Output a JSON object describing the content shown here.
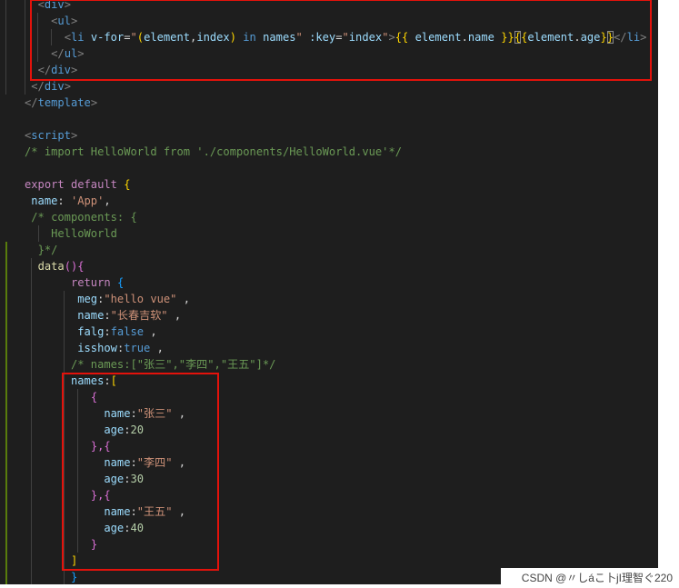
{
  "theme": {
    "editor_background": "#1e1e1e",
    "annotation_color": "#e3120b",
    "git_added_color": "#587c0c",
    "bracket_match_border": "#8b8b8b"
  },
  "editor": {
    "lines": [
      [
        [
          "  "
        ],
        [
          "<",
          "#808080"
        ],
        [
          "div",
          "#569cd6"
        ],
        [
          ">",
          "#808080"
        ]
      ],
      [
        [
          "    "
        ],
        [
          "<",
          "#808080"
        ],
        [
          "ul",
          "#569cd6"
        ],
        [
          ">",
          "#808080"
        ]
      ],
      [
        [
          "      "
        ],
        [
          "<",
          "#808080"
        ],
        [
          "li",
          "#569cd6"
        ],
        [
          " "
        ],
        [
          "v-for",
          "#9cdcfe"
        ],
        [
          "=",
          "#d4d4d4"
        ],
        [
          "\"",
          "#ce9178"
        ],
        [
          "(",
          "#ffd700"
        ],
        [
          "element",
          "#9cdcfe"
        ],
        [
          ",",
          "#d4d4d4"
        ],
        [
          "index",
          "#9cdcfe"
        ],
        [
          ")",
          "#ffd700"
        ],
        [
          " "
        ],
        [
          "in",
          "#569cd6"
        ],
        [
          " "
        ],
        [
          "names",
          "#9cdcfe"
        ],
        [
          "\"",
          "#ce9178"
        ],
        [
          " "
        ],
        [
          ":key",
          "#9cdcfe"
        ],
        [
          "=",
          "#d4d4d4"
        ],
        [
          "\"",
          "#ce9178"
        ],
        [
          "index",
          "#9cdcfe"
        ],
        [
          "\"",
          "#ce9178"
        ],
        [
          ">",
          "#808080"
        ],
        [
          "{{",
          "#ffd700"
        ],
        [
          " "
        ],
        [
          "element",
          "#9cdcfe"
        ],
        [
          ".",
          "#d4d4d4"
        ],
        [
          "name",
          "#9cdcfe"
        ],
        [
          " "
        ],
        [
          "}}",
          "#ffd700"
        ],
        [
          "{",
          "#ffd700",
          true
        ],
        [
          "{",
          "#ffd700"
        ],
        [
          "element",
          "#9cdcfe"
        ],
        [
          ".",
          "#d4d4d4"
        ],
        [
          "age",
          "#9cdcfe"
        ],
        [
          "}",
          "#ffd700"
        ],
        [
          "}",
          "#ffd700",
          true
        ],
        [
          "</",
          "#808080"
        ],
        [
          "li",
          "#569cd6"
        ],
        [
          ">",
          "#808080"
        ]
      ],
      [
        [
          "    "
        ],
        [
          "</",
          "#808080"
        ],
        [
          "ul",
          "#569cd6"
        ],
        [
          ">",
          "#808080"
        ]
      ],
      [
        [
          "  "
        ],
        [
          "</",
          "#808080"
        ],
        [
          "div",
          "#569cd6"
        ],
        [
          ">",
          "#808080"
        ]
      ],
      [
        [
          " "
        ],
        [
          "</",
          "#808080"
        ],
        [
          "div",
          "#569cd6"
        ],
        [
          ">",
          "#808080"
        ]
      ],
      [
        [
          "</",
          "#808080"
        ],
        [
          "template",
          "#569cd6"
        ],
        [
          ">",
          "#808080"
        ]
      ],
      [],
      [
        [
          "<",
          "#808080"
        ],
        [
          "script",
          "#569cd6"
        ],
        [
          ">",
          "#808080"
        ]
      ],
      [
        [
          "/* import HelloWorld from './components/HelloWorld.vue'*/",
          "#6a9955"
        ]
      ],
      [],
      [
        [
          "export",
          "#c586c0"
        ],
        [
          " "
        ],
        [
          "default",
          "#c586c0"
        ],
        [
          " "
        ],
        [
          "{",
          "#ffd700"
        ]
      ],
      [
        [
          " "
        ],
        [
          "name",
          "#9cdcfe"
        ],
        [
          ":",
          "#d4d4d4"
        ],
        [
          " "
        ],
        [
          "'App'",
          "#ce9178"
        ],
        [
          ",",
          "#d4d4d4"
        ]
      ],
      [
        [
          " "
        ],
        [
          "/* components: {",
          "#6a9955"
        ]
      ],
      [
        [
          "    "
        ],
        [
          "HelloWorld",
          "#6a9955"
        ]
      ],
      [
        [
          "  "
        ],
        [
          "}*/",
          "#6a9955"
        ]
      ],
      [
        [
          "  "
        ],
        [
          "data",
          "#dcdcaa"
        ],
        [
          "()",
          "#da70d6"
        ],
        [
          "{",
          "#da70d6"
        ]
      ],
      [
        [
          "       "
        ],
        [
          "return",
          "#c586c0"
        ],
        [
          " "
        ],
        [
          "{",
          "#179fff"
        ]
      ],
      [
        [
          "        "
        ],
        [
          "meg",
          "#9cdcfe"
        ],
        [
          ":",
          "#d4d4d4"
        ],
        [
          "\"hello vue\"",
          "#ce9178"
        ],
        [
          " ,",
          "#d4d4d4"
        ]
      ],
      [
        [
          "        "
        ],
        [
          "name",
          "#9cdcfe"
        ],
        [
          ":",
          "#d4d4d4"
        ],
        [
          "\"长春吉软\"",
          "#ce9178"
        ],
        [
          " ,",
          "#d4d4d4"
        ]
      ],
      [
        [
          "        "
        ],
        [
          "falg",
          "#9cdcfe"
        ],
        [
          ":",
          "#d4d4d4"
        ],
        [
          "false",
          "#569cd6"
        ],
        [
          " ,",
          "#d4d4d4"
        ]
      ],
      [
        [
          "        "
        ],
        [
          "isshow",
          "#9cdcfe"
        ],
        [
          ":",
          "#d4d4d4"
        ],
        [
          "true",
          "#569cd6"
        ],
        [
          " ,",
          "#d4d4d4"
        ]
      ],
      [
        [
          "       "
        ],
        [
          "/* names:[\"张三\",\"李四\",\"王五\"]*/",
          "#6a9955"
        ]
      ],
      [
        [
          "       "
        ],
        [
          "names",
          "#9cdcfe"
        ],
        [
          ":",
          "#d4d4d4"
        ],
        [
          "[",
          "#ffd700"
        ]
      ],
      [
        [
          "          "
        ],
        [
          "{",
          "#da70d6"
        ]
      ],
      [
        [
          "            "
        ],
        [
          "name",
          "#9cdcfe"
        ],
        [
          ":",
          "#d4d4d4"
        ],
        [
          "\"张三\"",
          "#ce9178"
        ],
        [
          " ,",
          "#d4d4d4"
        ]
      ],
      [
        [
          "            "
        ],
        [
          "age",
          "#9cdcfe"
        ],
        [
          ":",
          "#d4d4d4"
        ],
        [
          "20",
          "#b5cea8"
        ]
      ],
      [
        [
          "          "
        ],
        [
          "},{",
          "#da70d6"
        ]
      ],
      [
        [
          "            "
        ],
        [
          "name",
          "#9cdcfe"
        ],
        [
          ":",
          "#d4d4d4"
        ],
        [
          "\"李四\"",
          "#ce9178"
        ],
        [
          " ,",
          "#d4d4d4"
        ]
      ],
      [
        [
          "            "
        ],
        [
          "age",
          "#9cdcfe"
        ],
        [
          ":",
          "#d4d4d4"
        ],
        [
          "30",
          "#b5cea8"
        ]
      ],
      [
        [
          "          "
        ],
        [
          "},{",
          "#da70d6"
        ]
      ],
      [
        [
          "            "
        ],
        [
          "name",
          "#9cdcfe"
        ],
        [
          ":",
          "#d4d4d4"
        ],
        [
          "\"王五\"",
          "#ce9178"
        ],
        [
          " ,",
          "#d4d4d4"
        ]
      ],
      [
        [
          "            "
        ],
        [
          "age",
          "#9cdcfe"
        ],
        [
          ":",
          "#d4d4d4"
        ],
        [
          "40",
          "#b5cea8"
        ]
      ],
      [
        [
          "          "
        ],
        [
          "}",
          "#da70d6"
        ]
      ],
      [
        [
          "       "
        ],
        [
          "]",
          "#ffd700"
        ]
      ],
      [
        [
          "       "
        ],
        [
          "}",
          "#179fff"
        ]
      ]
    ]
  },
  "watermark": "CSDN @〃しáこ卜jI理智ぐ220"
}
